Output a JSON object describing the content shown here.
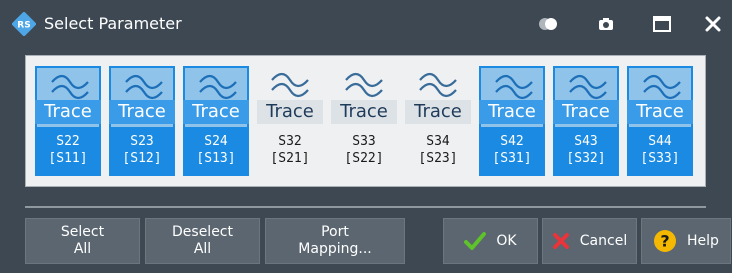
{
  "window": {
    "title": "Select Parameter",
    "title_icon": "rs-logo-icon"
  },
  "titlebar_buttons": [
    {
      "icon": "toggle-icon"
    },
    {
      "icon": "camera-icon"
    },
    {
      "icon": "maximize-icon"
    },
    {
      "icon": "close-icon"
    }
  ],
  "traces": [
    {
      "word": "Trace",
      "line1": "S22",
      "line2": "[S11]",
      "selected": true
    },
    {
      "word": "Trace",
      "line1": "S23",
      "line2": "[S12]",
      "selected": true
    },
    {
      "word": "Trace",
      "line1": "S24",
      "line2": "[S13]",
      "selected": true
    },
    {
      "word": "Trace",
      "line1": "S32",
      "line2": "[S21]",
      "selected": false
    },
    {
      "word": "Trace",
      "line1": "S33",
      "line2": "[S22]",
      "selected": false
    },
    {
      "word": "Trace",
      "line1": "S34",
      "line2": "[S23]",
      "selected": false
    },
    {
      "word": "Trace",
      "line1": "S42",
      "line2": "[S31]",
      "selected": true
    },
    {
      "word": "Trace",
      "line1": "S43",
      "line2": "[S32]",
      "selected": true
    },
    {
      "word": "Trace",
      "line1": "S44",
      "line2": "[S33]",
      "selected": true
    }
  ],
  "buttons": {
    "select_all_1": "Select",
    "select_all_2": "All",
    "deselect_all_1": "Deselect",
    "deselect_all_2": "All",
    "port_mapping_1": "Port",
    "port_mapping_2": "Mapping...",
    "ok": "OK",
    "cancel": "Cancel",
    "help": "Help"
  },
  "colors": {
    "accent": "#1a8ae2",
    "ok_check": "#5ec22a",
    "cancel_x": "#e8343a",
    "help_circle": "#f5b800"
  }
}
